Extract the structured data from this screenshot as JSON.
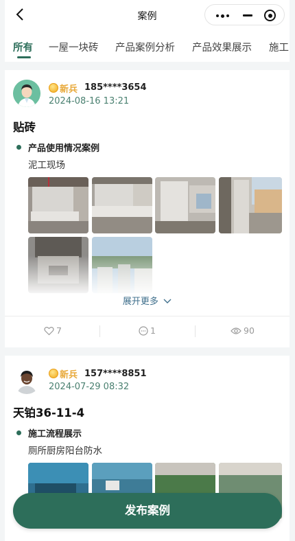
{
  "header": {
    "title": "案例"
  },
  "tabs": [
    {
      "label": "所有"
    },
    {
      "label": "一屋一块砖"
    },
    {
      "label": "产品案例分析"
    },
    {
      "label": "产品效果展示"
    },
    {
      "label": "施工"
    }
  ],
  "posts": [
    {
      "rank": "新兵",
      "username": "185****3654",
      "date": "2024-08-16 13:21",
      "title": "贴砖",
      "category": "产品使用情况案例",
      "subtitle": "泥工现场",
      "expand_label": "展开更多",
      "likes": "7",
      "comments": "1",
      "views": "90"
    },
    {
      "rank": "新兵",
      "username": "157****8851",
      "date": "2024-07-29 08:32",
      "title": "天铂36-11-4",
      "category": "施工流程展示",
      "subtitle": "厕所厨房阳台防水"
    }
  ],
  "publish_label": "发布案例",
  "colors": {
    "accent": "#2d6e5a",
    "rank": "#e8a93a",
    "date": "#4a8070"
  }
}
